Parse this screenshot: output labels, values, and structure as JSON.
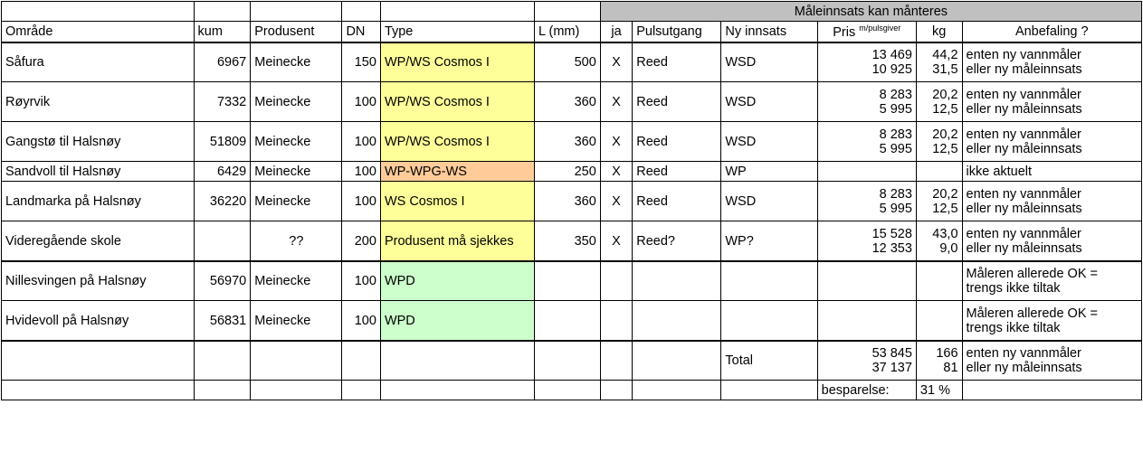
{
  "header": {
    "group_title": "Måleinnsats kan månteres",
    "omrade": "Område",
    "kum": "kum",
    "produsent": "Produsent",
    "dn": "DN",
    "type": "Type",
    "l_mm": "L (mm)",
    "ja": "ja",
    "pulsutgang": "Pulsutgang",
    "ny_innsats": "Ny innsats",
    "pris_pre": "Pris ",
    "pris_sup": "m/pulsgiver",
    "kg": "kg",
    "anbefaling": "Anbefaling ?"
  },
  "rows": [
    {
      "omrade": "Såfura",
      "kum": "6967",
      "produsent": "Meinecke",
      "dn": "150",
      "type": "WP/WS Cosmos I",
      "typeCls": "yellow",
      "l": "500",
      "ja": "X",
      "puls": "Reed",
      "ny": "WSD",
      "pris": "13 469\n10 925",
      "kg": "44,2\n31,5",
      "anbef": "enten ny vannmåler\neller ny måleinnsats",
      "tall": true
    },
    {
      "omrade": "Røyrvik",
      "kum": "7332",
      "produsent": "Meinecke",
      "dn": "100",
      "type": "WP/WS Cosmos I",
      "typeCls": "yellow",
      "l": "360",
      "ja": "X",
      "puls": "Reed",
      "ny": "WSD",
      "pris": "8 283\n5 995",
      "kg": "20,2\n12,5",
      "anbef": "enten ny vannmåler\neller ny måleinnsats",
      "tall": true
    },
    {
      "omrade": "Gangstø til Halsnøy",
      "kum": "51809",
      "produsent": "Meinecke",
      "dn": "100",
      "type": "WP/WS Cosmos I",
      "typeCls": "yellow",
      "l": "360",
      "ja": "X",
      "puls": "Reed",
      "ny": "WSD",
      "pris": "8 283\n5 995",
      "kg": "20,2\n12,5",
      "anbef": "enten ny vannmåler\neller ny måleinnsats",
      "tall": true
    },
    {
      "omrade": "Sandvoll til Halsnøy",
      "kum": "6429",
      "produsent": "Meinecke",
      "dn": "100",
      "type": "WP-WPG-WS",
      "typeCls": "orange",
      "l": "250",
      "ja": "X",
      "puls": "Reed",
      "ny": "WP",
      "pris": "",
      "kg": "",
      "anbef": "ikke aktuelt",
      "tall": false
    },
    {
      "omrade": "Landmarka på Halsnøy",
      "kum": "36220",
      "produsent": "Meinecke",
      "dn": "100",
      "type": "WS Cosmos I",
      "typeCls": "yellow",
      "l": "360",
      "ja": "X",
      "puls": "Reed",
      "ny": "WSD",
      "pris": "8 283\n5 995",
      "kg": "20,2\n12,5",
      "anbef": "enten ny vannmåler\neller ny måleinnsats",
      "tall": true
    },
    {
      "omrade": "Videregående skole",
      "kum": "",
      "produsent": "??",
      "dn": "200",
      "type": "Produsent må sjekkes",
      "typeCls": "yellow",
      "l": "350",
      "ja": "X",
      "puls": "Reed?",
      "ny": "WP?",
      "pris": "15 528\n12 353",
      "kg": "43,0\n9,0",
      "anbef": "enten ny vannmåler\neller ny måleinnsats",
      "tall": true,
      "thickBot": true,
      "prodCenter": true
    },
    {
      "omrade": "Nillesvingen på Halsnøy",
      "kum": "56970",
      "produsent": "Meinecke",
      "dn": "100",
      "type": "WPD",
      "typeCls": "green",
      "l": "",
      "ja": "",
      "puls": "",
      "ny": "",
      "pris": "",
      "kg": "",
      "anbef": "Måleren allerede OK = trengs ikke tiltak",
      "tall": true
    },
    {
      "omrade": "Hvidevoll på Halsnøy",
      "kum": "56831",
      "produsent": "Meinecke",
      "dn": "100",
      "type": "WPD",
      "typeCls": "green",
      "l": "",
      "ja": "",
      "puls": "",
      "ny": "",
      "pris": "",
      "kg": "",
      "anbef": "Måleren allerede OK = trengs ikke tiltak",
      "tall": true,
      "thickBot": true
    }
  ],
  "totals": {
    "label": "Total",
    "pris": "53 845\n37 137",
    "kg": "166\n81",
    "anbef": "enten ny vannmåler\neller ny måleinnsats",
    "besparelse_label": "besparelse:",
    "besparelse_val": "31 %"
  }
}
